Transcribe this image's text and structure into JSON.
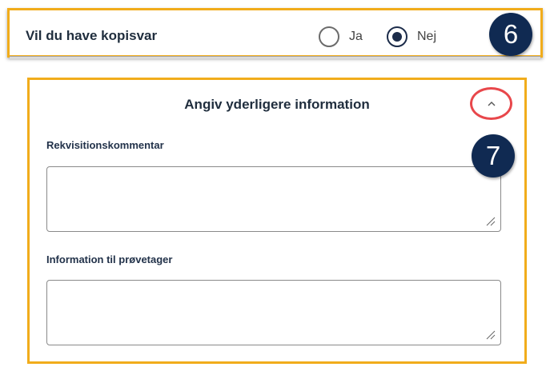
{
  "copy_answer": {
    "question": "Vil du have kopisvar",
    "options": [
      {
        "label": "Ja",
        "selected": false
      },
      {
        "label": "Nej",
        "selected": true
      }
    ],
    "badge": "6"
  },
  "additional_info": {
    "title": "Angiv yderligere information",
    "collapse_icon": "chevron-up-icon",
    "badge": "7",
    "fields": [
      {
        "label": "Rekvisitionskommentar",
        "value": ""
      },
      {
        "label": "Information til prøvetager",
        "value": ""
      }
    ]
  },
  "colors": {
    "highlight_border": "#f1ac1b",
    "badge_bg": "#102a52",
    "circle_highlight": "#e8474b",
    "radio_selected": "#1c2c4a"
  }
}
